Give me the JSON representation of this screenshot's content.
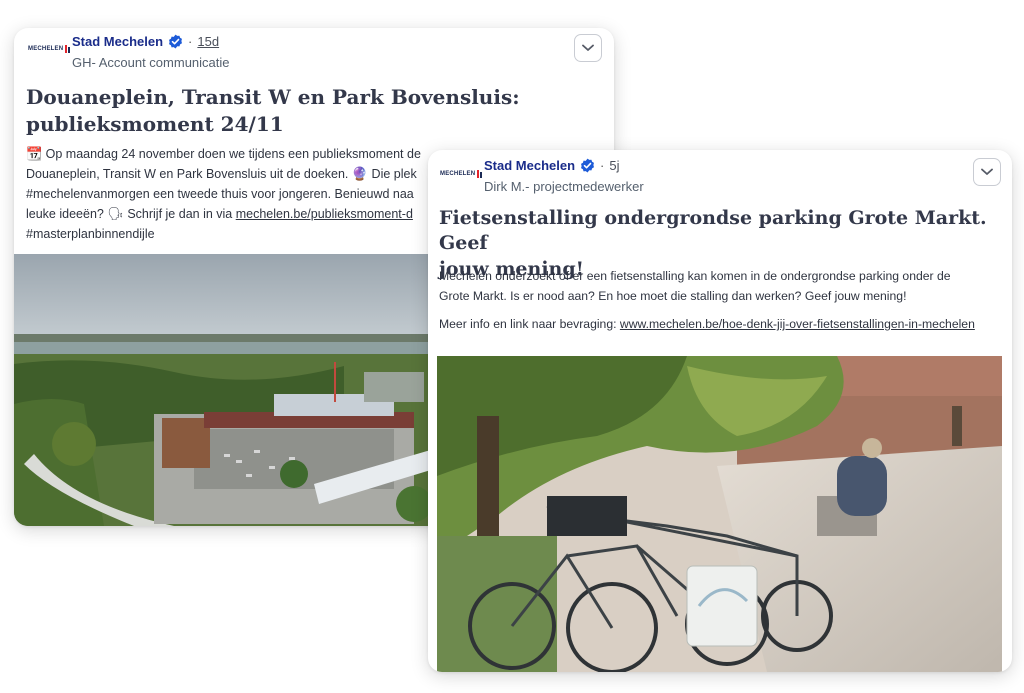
{
  "posts": [
    {
      "logo_text": "MECHELEN",
      "author": "Stad Mechelen",
      "time": "15d",
      "subtitle": "GH- Account communicatie",
      "title_line1": "Douaneplein, Transit W en Park Bovensluis:",
      "title_line2": "publieksmoment 24/11",
      "body_emoji1": "📆",
      "body_line1": " Op maandag 24 november doen we tijdens een publieksmoment de",
      "body_line2": "Douaneplein, Transit W en Park Bovensluis uit de doeken.",
      "body_emoji2": "🔮",
      "body_line2b": " Die plek",
      "body_line3": "#mechelenvanmorgen een tweede thuis voor jongeren. Benieuwd naa",
      "body_line4a": "leuke ideeën?",
      "body_emoji3": "🗣",
      "body_line4b": " Schrijf je dan in via ",
      "body_link": "mechelen.be/publieksmoment-d",
      "body_line5": "#masterplanbinnendijle"
    },
    {
      "logo_text": "MECHELEN",
      "author": "Stad Mechelen",
      "time": "5j",
      "subtitle": "Dirk M.- projectmedewerker",
      "title_line1": "Fietsenstalling ondergrondse parking Grote Markt. Geef",
      "title_line2": "jouw mening!",
      "body_line1": "Mechelen onderzoekt of er een fietsenstalling kan komen in de ondergrondse parking onder de",
      "body_line2": "Grote Markt. Is er nood aan? En hoe moet die stalling dan werken? Geef jouw mening!",
      "body_line3": "Meer info en link naar bevraging: ",
      "body_link": "www.mechelen.be/hoe-denk-jij-over-fietsenstallingen-in-mechelen"
    }
  ],
  "colors": {
    "author": "#1a2c8a",
    "verified": "#1d5bd8",
    "title": "#33384a"
  },
  "icons": {
    "verified": "verified-badge-icon",
    "menu": "chevron-down-icon"
  }
}
